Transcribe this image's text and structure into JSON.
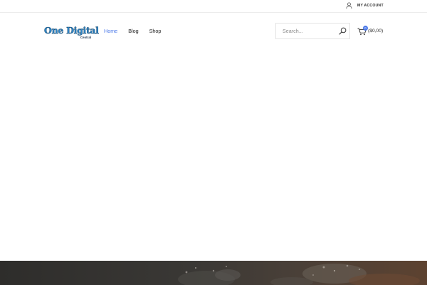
{
  "topbar": {
    "account_label": "MY ACCOUNT",
    "account_icon": "user-icon"
  },
  "header": {
    "logo": {
      "main_text": "One Digital",
      "sub_text": "Central"
    },
    "nav": [
      {
        "label": "Home",
        "active": true
      },
      {
        "label": "Blog",
        "active": false
      },
      {
        "label": "Shop",
        "active": false
      }
    ],
    "search": {
      "placeholder": "Search...",
      "icon": "search-icon"
    },
    "cart": {
      "count": "0",
      "total": "($0,00)",
      "icon": "shopping-cart-icon"
    }
  },
  "colors": {
    "accent": "#4a78e8",
    "logo_blue": "#2f86c8",
    "hero_dark": "#2e2d2b",
    "hero_warm": "#5d4230"
  }
}
